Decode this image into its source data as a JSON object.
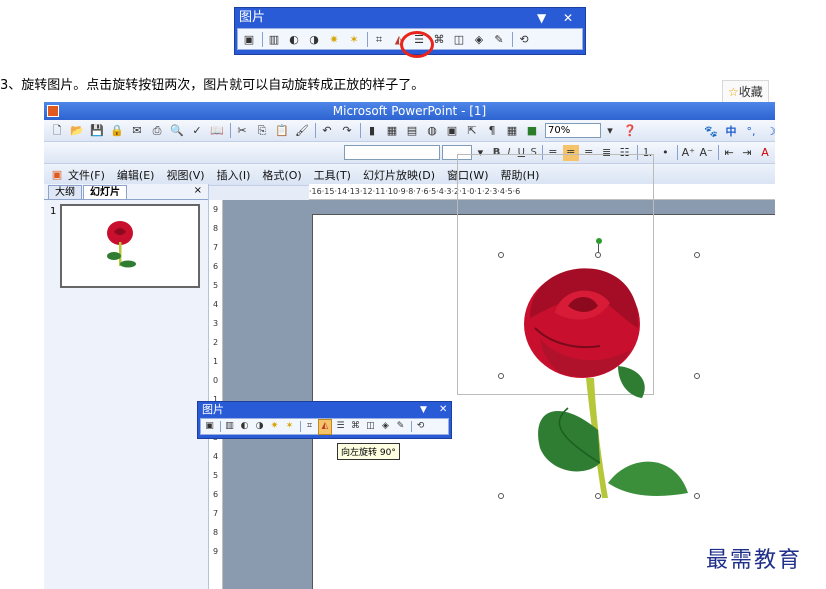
{
  "picture_toolbar": {
    "title": "图片",
    "dropdown_icon": "triangle-down-icon",
    "close_icon": "close-icon",
    "tools": [
      "insert-picture-icon",
      "color-icon",
      "more-contrast-icon",
      "less-contrast-icon",
      "more-brightness-icon",
      "less-brightness-icon",
      "crop-icon",
      "rotate-left-icon",
      "line-style-icon",
      "compress-picture-icon",
      "text-wrapping-icon",
      "format-picture-icon",
      "set-transparent-color-icon",
      "reset-picture-icon"
    ],
    "highlight_color": "#e8241c"
  },
  "caption": "3、旋转图片。点击旋转按钮两次，图片就可以自动旋转成正放的样子了。",
  "favorite": {
    "star": "☆",
    "label": "收藏"
  },
  "ppt": {
    "title": "Microsoft PowerPoint - [1]",
    "zoom": "70%",
    "menu": [
      "文件(F)",
      "编辑(E)",
      "视图(V)",
      "插入(I)",
      "格式(O)",
      "工具(T)",
      "幻灯片放映(D)",
      "窗口(W)",
      "帮助(H)"
    ],
    "ime": {
      "lang": "中"
    },
    "format_buttons": [
      "B",
      "I",
      "U",
      "S"
    ],
    "panel_tabs": [
      "大纲",
      "幻灯片"
    ],
    "panel_close": "×",
    "slide_number": "1",
    "hruler_text": "·16·15·14·13·12·11·10·9·8·7·6·5·4·3·2·1·0·1·2·3·4·5·6",
    "vruler_marks": [
      "9",
      "8",
      "7",
      "6",
      "5",
      "4",
      "3",
      "2",
      "1",
      "0",
      "1",
      "2",
      "3",
      "4",
      "5",
      "6",
      "7",
      "8",
      "9"
    ]
  },
  "floating_toolbar": {
    "title": "图片",
    "tooltip": "向左旋转 90°"
  },
  "colors": {
    "petal": "#c8102e",
    "petal_dark": "#8d0a1e",
    "leaf": "#2e7d32",
    "stem": "#b6c83a"
  },
  "watermark": "最需教育"
}
